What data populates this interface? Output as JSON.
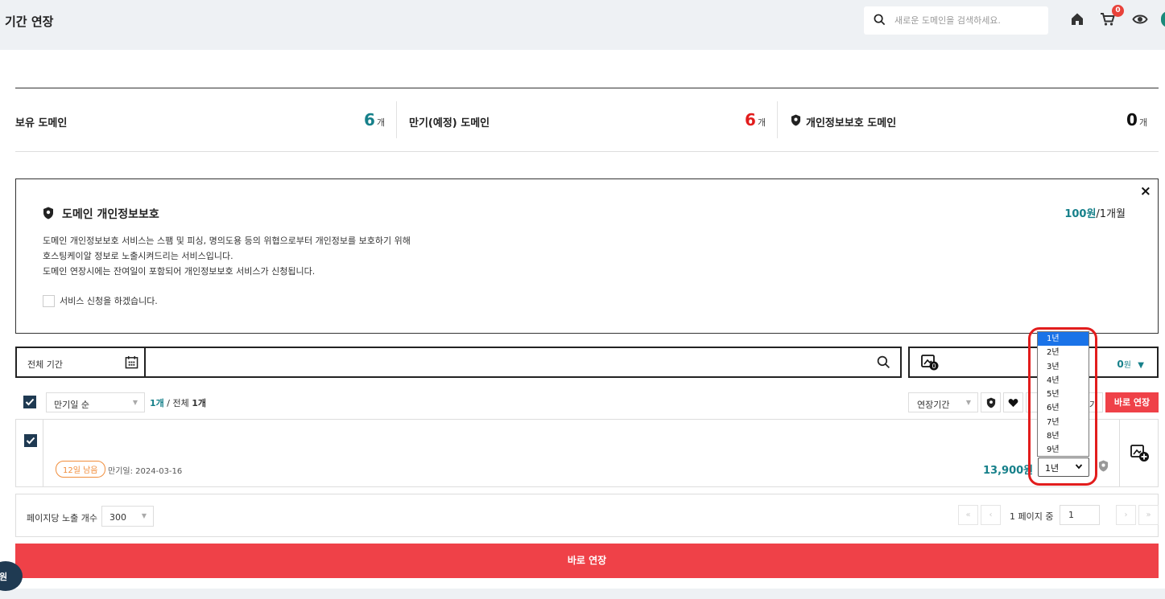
{
  "header": {
    "title": "기간 연장",
    "search_placeholder": "새로운 도메인을 검색하세요.",
    "cart_badge": "0",
    "colors": {
      "accent": "#16808a",
      "brand_red": "#ef4148",
      "dark": "#1f3a52",
      "badge": "#e8423a"
    }
  },
  "summary": {
    "owned_label": "보유 도메인",
    "owned_count": "6",
    "expiring_label": "만기(예정) 도메인",
    "expiring_count": "6",
    "privacy_label": "개인정보보호 도메인",
    "privacy_count": "0",
    "unit": "개"
  },
  "privacy_panel": {
    "title": "도메인 개인정보보호",
    "price_amount": "100원",
    "price_period": "/1개월",
    "desc_line1": "도메인 개인정보보호 서비스는 스팸 및 피싱, 명의도용 등의 위협으로부터 개인정보를 보호하기 위해",
    "desc_line2": "호스팅케이알 정보로 노출시켜드리는 서비스입니다.",
    "desc_line3": "도메인 연장시에는 잔여일이 포함되어 개인정보보호 서비스가 신청됩니다.",
    "checkbox_label": "서비스 신청을 하겠습니다.",
    "close": "×"
  },
  "filter": {
    "period_label": "전체 기간",
    "cart_amount": "0",
    "cart_unit": "원",
    "cart_caret": "▼"
  },
  "toolbar": {
    "sort_value": "만기일 순",
    "count_selected": "1개",
    "count_sep": " / 전체 ",
    "count_total": "1개",
    "period_select": "연장기간",
    "partial_label": "기",
    "buy_now": "바로 연장"
  },
  "row": {
    "badge": "12일 남음",
    "expiry": "만기일: 2024-03-16",
    "price": "13,900원",
    "year_value": "1년"
  },
  "year_options": [
    "1년",
    "2년",
    "3년",
    "4년",
    "5년",
    "6년",
    "7년",
    "8년",
    "9년"
  ],
  "pager": {
    "per_page_label": "페이지당 노출 개수",
    "per_page_value": "300",
    "first": "«",
    "prev": "‹",
    "next": "›",
    "last": "»",
    "page_text": "1 페이지 중",
    "current_page": "1"
  },
  "footer": {
    "buy_now_big": "바로 연장",
    "floating_text": "원"
  }
}
